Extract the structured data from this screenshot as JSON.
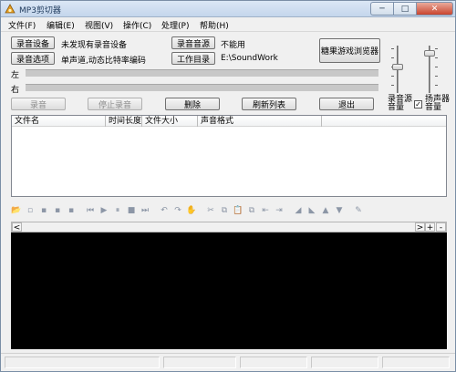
{
  "window": {
    "title": "MP3剪切器",
    "min_glyph": "─",
    "max_glyph": "□",
    "close_glyph": "✕"
  },
  "menu": [
    "文件(F)",
    "编辑(E)",
    "视图(V)",
    "操作(C)",
    "处理(P)",
    "帮助(H)"
  ],
  "record": {
    "device_button": "录音设备",
    "device_status": "未发现有录音设备",
    "options_button": "录音选项",
    "options_status": "单声道,动态比特率编码",
    "source_button": "录音音源",
    "source_status": "不能用",
    "dir_button": "工作目录",
    "dir_value": "E:\\SoundWork",
    "game_button": "糖果游戏浏览器"
  },
  "meters": {
    "left_label": "左",
    "right_label": "右"
  },
  "actions": {
    "record": "录音",
    "stop_record": "停止录音",
    "delete": "删除",
    "refresh": "刷新列表",
    "exit": "退出"
  },
  "volume": {
    "source_label": "录音源音量",
    "speaker_label": "扬声器音量",
    "speaker_checked": true,
    "check_glyph": "✓",
    "source_level": 0.55,
    "speaker_level": 0.9
  },
  "list": {
    "columns": [
      "文件名",
      "时间长度",
      "文件大小",
      "声音格式"
    ]
  },
  "toolbar": {
    "icons": [
      {
        "name": "open-folder-icon",
        "glyph": "📂",
        "active": true
      },
      {
        "name": "new-file-icon",
        "glyph": "▫",
        "active": false
      },
      {
        "name": "save-icon",
        "glyph": "▪",
        "active": false
      },
      {
        "name": "save-as-icon",
        "glyph": "▪",
        "active": false
      },
      {
        "name": "export-icon",
        "glyph": "▪",
        "active": false
      },
      {
        "name": "skip-start-icon",
        "glyph": "⏮",
        "active": false
      },
      {
        "name": "play-icon",
        "glyph": "▶",
        "active": false
      },
      {
        "name": "pause-icon",
        "glyph": "⏸",
        "active": false
      },
      {
        "name": "stop-icon",
        "glyph": "■",
        "active": false
      },
      {
        "name": "skip-end-icon",
        "glyph": "⏭",
        "active": false
      },
      {
        "name": "undo-icon",
        "glyph": "↶",
        "active": false
      },
      {
        "name": "redo-icon",
        "glyph": "↷",
        "active": false
      },
      {
        "name": "hand-icon",
        "glyph": "✋",
        "active": false
      },
      {
        "name": "cut-icon",
        "glyph": "✂",
        "active": false
      },
      {
        "name": "copy-icon",
        "glyph": "⧉",
        "active": false
      },
      {
        "name": "paste-icon",
        "glyph": "📋",
        "active": false
      },
      {
        "name": "mix-icon",
        "glyph": "⧉",
        "active": false
      },
      {
        "name": "trim-left-icon",
        "glyph": "⇤",
        "active": false
      },
      {
        "name": "trim-right-icon",
        "glyph": "⇥",
        "active": false
      },
      {
        "name": "fade-in-icon",
        "glyph": "◢",
        "active": false
      },
      {
        "name": "fade-out-icon",
        "glyph": "◣",
        "active": false
      },
      {
        "name": "volume-up-icon",
        "glyph": "▲",
        "active": false
      },
      {
        "name": "volume-down-icon",
        "glyph": "▼",
        "active": false
      },
      {
        "name": "effects-icon",
        "glyph": "✎",
        "active": false
      }
    ]
  },
  "scroll": {
    "left_glyph": "<",
    "right_glyph": ">",
    "plus_glyph": "+",
    "minus_glyph": "-"
  },
  "colors": {
    "waveform_bg": "#000000"
  }
}
